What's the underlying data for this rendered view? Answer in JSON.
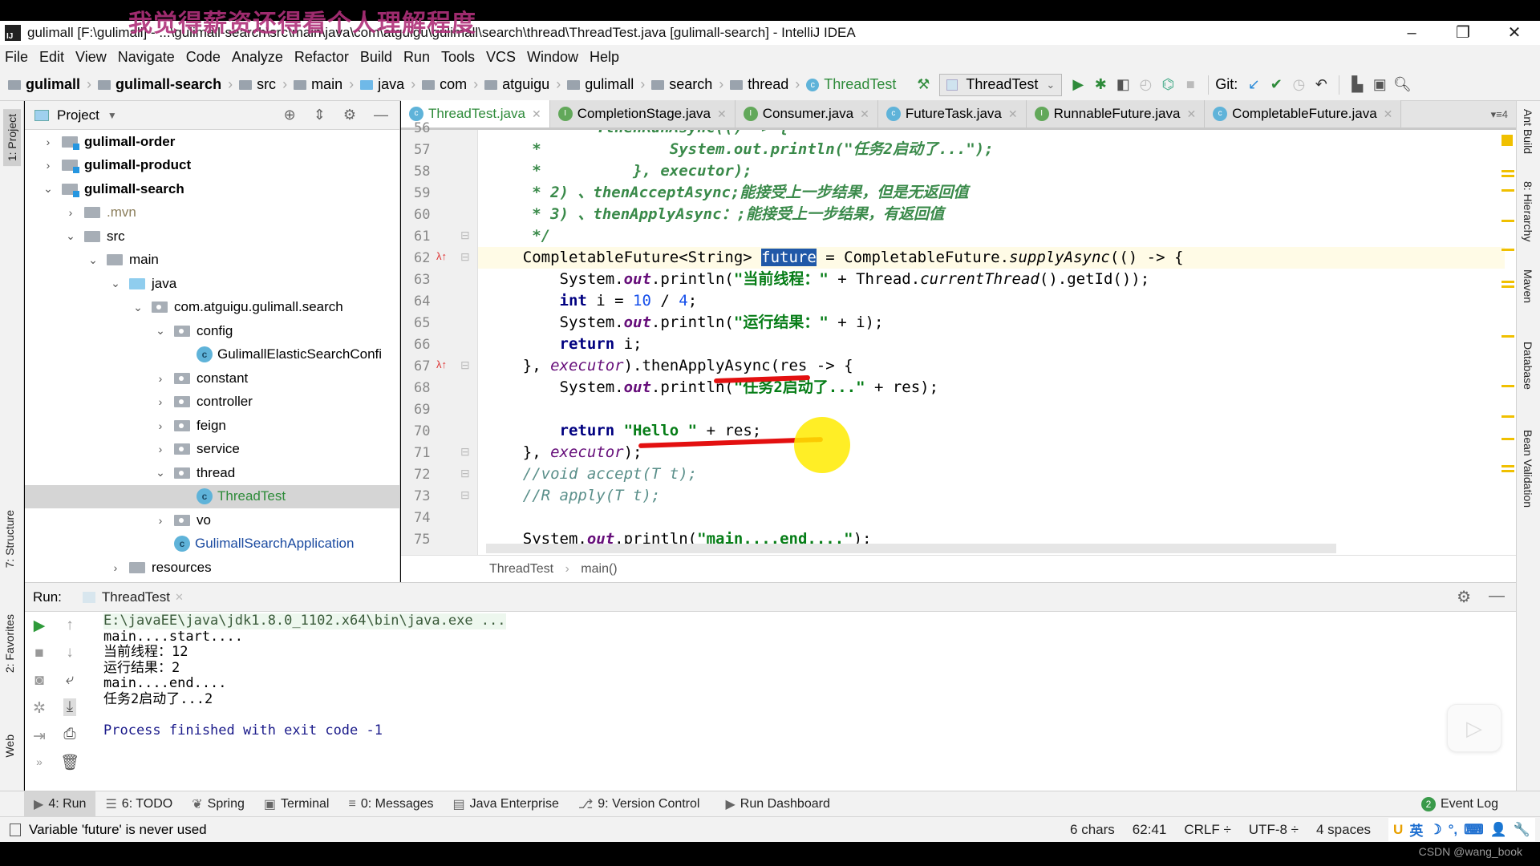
{
  "overlay_caption": "我觉得薪资还得看个人理解程度",
  "window": {
    "logo": "IJ",
    "title": "gulimall [F:\\gulimall] - ...\\gulimall-search\\src\\main\\java\\com\\atguigu\\gulimall\\search\\thread\\ThreadTest.java [gulimall-search] - IntelliJ IDEA",
    "minimize": "–",
    "restore": "❐",
    "close": "✕"
  },
  "menu": [
    "File",
    "Edit",
    "View",
    "Navigate",
    "Code",
    "Analyze",
    "Refactor",
    "Build",
    "Run",
    "Tools",
    "VCS",
    "Window",
    "Help"
  ],
  "breadcrumb": [
    {
      "label": "gulimall",
      "bold": true
    },
    {
      "label": "gulimall-search",
      "bold": true
    },
    {
      "label": "src"
    },
    {
      "label": "main"
    },
    {
      "label": "java",
      "blue": true
    },
    {
      "label": "com"
    },
    {
      "label": "atguigu"
    },
    {
      "label": "gulimall"
    },
    {
      "label": "search"
    },
    {
      "label": "thread"
    },
    {
      "label": "ThreadTest",
      "class": true
    }
  ],
  "toolbar": {
    "build_icon": "hammer-icon",
    "run_config": "ThreadTest",
    "git_label": "Git:",
    "icons": [
      "run-icon",
      "debug-icon",
      "coverage-icon",
      "profile-icon",
      "attach-debug-icon",
      "stop-icon"
    ],
    "git_icons": [
      "update-icon",
      "commit-icon",
      "history-icon",
      "revert-icon"
    ],
    "right_icons": [
      "project-structure-icon",
      "presentation-icon",
      "search-icon"
    ]
  },
  "left_strip": {
    "project": "1: Project",
    "structure": "7: Structure",
    "favorites": "2: Favorites",
    "web": "Web"
  },
  "right_strip": [
    "Ant Build",
    "8: Hierarchy",
    "Maven",
    "Database",
    "Bean Validation"
  ],
  "project_panel": {
    "title": "Project",
    "tree": [
      {
        "label": "gulimall-order",
        "depth": 0,
        "arrow": "›",
        "type": "module",
        "bold": true
      },
      {
        "label": "gulimall-product",
        "depth": 0,
        "arrow": "›",
        "type": "module",
        "bold": true
      },
      {
        "label": "gulimall-search",
        "depth": 0,
        "arrow": "⌄",
        "type": "module",
        "bold": true
      },
      {
        "label": ".mvn",
        "depth": 1,
        "arrow": "›",
        "type": "folder",
        "muted": true
      },
      {
        "label": "src",
        "depth": 1,
        "arrow": "⌄",
        "type": "folder"
      },
      {
        "label": "main",
        "depth": 2,
        "arrow": "⌄",
        "type": "folder"
      },
      {
        "label": "java",
        "depth": 3,
        "arrow": "⌄",
        "type": "source"
      },
      {
        "label": "com.atguigu.gulimall.search",
        "depth": 4,
        "arrow": "⌄",
        "type": "package"
      },
      {
        "label": "config",
        "depth": 5,
        "arrow": "⌄",
        "type": "package"
      },
      {
        "label": "GulimallElasticSearchConfi",
        "depth": 6,
        "arrow": "",
        "type": "class"
      },
      {
        "label": "constant",
        "depth": 5,
        "arrow": "›",
        "type": "package"
      },
      {
        "label": "controller",
        "depth": 5,
        "arrow": "›",
        "type": "package"
      },
      {
        "label": "feign",
        "depth": 5,
        "arrow": "›",
        "type": "package"
      },
      {
        "label": "service",
        "depth": 5,
        "arrow": "›",
        "type": "package"
      },
      {
        "label": "thread",
        "depth": 5,
        "arrow": "⌄",
        "type": "package"
      },
      {
        "label": "ThreadTest",
        "depth": 6,
        "arrow": "",
        "type": "runclass",
        "selected": true
      },
      {
        "label": "vo",
        "depth": 5,
        "arrow": "›",
        "type": "package"
      },
      {
        "label": "GulimallSearchApplication",
        "depth": 5,
        "arrow": "",
        "type": "app"
      },
      {
        "label": "resources",
        "depth": 3,
        "arrow": "›",
        "type": "resources"
      }
    ]
  },
  "editor": {
    "tabs": [
      {
        "label": "ThreadTest.java",
        "icon": "c",
        "active": true
      },
      {
        "label": "CompletionStage.java",
        "icon": "i"
      },
      {
        "label": "Consumer.java",
        "icon": "i"
      },
      {
        "label": "FutureTask.java",
        "icon": "c"
      },
      {
        "label": "RunnableFuture.java",
        "icon": "i"
      },
      {
        "label": "CompletableFuture.java",
        "icon": "c"
      }
    ],
    "tab_overflow": "▾≡4",
    "line_numbers": [
      "56",
      "57",
      "58",
      "59",
      "60",
      "61",
      "62",
      "63",
      "64",
      "65",
      "66",
      "67",
      "68",
      "69",
      "70",
      "71",
      "72",
      "73",
      "74",
      "75"
    ],
    "highlight_word": "future",
    "code_breadcrumb": [
      "ThreadTest",
      "main()"
    ]
  },
  "run_panel": {
    "label": "Run:",
    "tab": "ThreadTest",
    "output": [
      "E:\\javaEE\\java\\jdk1.8.0_1102.x64\\bin\\java.exe ...",
      "main....start....",
      "当前线程：12",
      "运行结果：2",
      "main....end....",
      "任务2启动了...2",
      "",
      "Process finished with exit code -1"
    ]
  },
  "bottom_tools": [
    {
      "label": "4: Run",
      "icon": "▶",
      "active": true
    },
    {
      "label": "6: TODO",
      "icon": "☰"
    },
    {
      "label": "Spring",
      "icon": "❦"
    },
    {
      "label": "Terminal",
      "icon": "▣"
    },
    {
      "label": "0: Messages",
      "icon": "≡"
    },
    {
      "label": "Java Enterprise",
      "icon": "▤"
    },
    {
      "label": "9: Version Control",
      "icon": "⎇"
    },
    {
      "label": "Run Dashboard",
      "icon": "▶"
    }
  ],
  "event_log": {
    "count": "2",
    "label": "Event Log"
  },
  "status": {
    "message": "Variable 'future' is never used",
    "chars": "6 chars",
    "position": "62:41",
    "line_sep": "CRLF ÷",
    "encoding": "UTF-8 ÷",
    "indent": "4 spaces",
    "ime": [
      "U",
      "英",
      "☽",
      "°,",
      "⌨",
      "👤",
      "🔧"
    ]
  },
  "watermark": "CSDN @wang_book"
}
